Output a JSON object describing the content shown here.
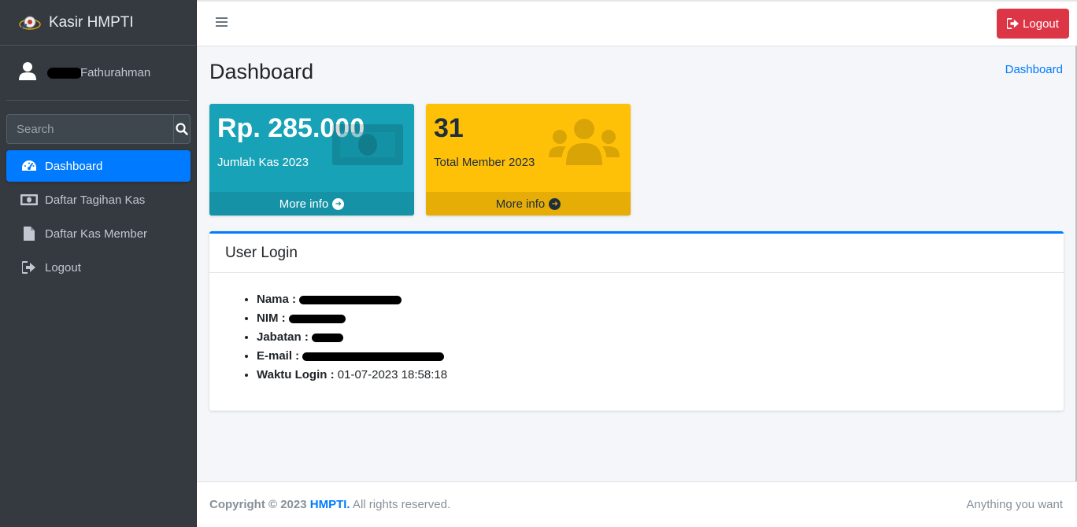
{
  "brand": {
    "name": "Kasir HMPTI"
  },
  "user_panel": {
    "name": "Fathurahman"
  },
  "search": {
    "placeholder": "Search"
  },
  "nav": [
    {
      "label": "Dashboard",
      "icon": "tachometer-icon"
    },
    {
      "label": "Daftar Tagihan Kas",
      "icon": "money-bill-icon"
    },
    {
      "label": "Daftar Kas Member",
      "icon": "file-icon"
    },
    {
      "label": "Logout",
      "icon": "sign-out-icon"
    }
  ],
  "topbar": {
    "logout_label": "Logout"
  },
  "page": {
    "title": "Dashboard",
    "breadcrumb": "Dashboard"
  },
  "boxes": [
    {
      "value": "Rp. 285.000",
      "label": "Jumlah Kas 2023",
      "footer": "More info",
      "color": "#17a2b8",
      "icon": "money-bill-icon"
    },
    {
      "value": "31",
      "label": "Total Member 2023",
      "footer": "More info",
      "color": "#ffc107",
      "icon": "users-icon"
    }
  ],
  "user_login": {
    "title": "User Login",
    "fields": [
      {
        "label": "Nama :",
        "value": ""
      },
      {
        "label": "NIM :",
        "value": ""
      },
      {
        "label": "Jabatan :",
        "value": ""
      },
      {
        "label": "E-mail :",
        "value": ""
      },
      {
        "label": "Waktu Login :",
        "value": "01-07-2023 18:58:18"
      }
    ]
  },
  "footer": {
    "copyright": "Copyright © 2023 ",
    "org": "HMPTI.",
    "rights": " All rights reserved.",
    "right_text": "Anything you want"
  },
  "colors": {
    "primary": "#007bff",
    "danger": "#dc3545",
    "sidebar": "#343a40"
  }
}
